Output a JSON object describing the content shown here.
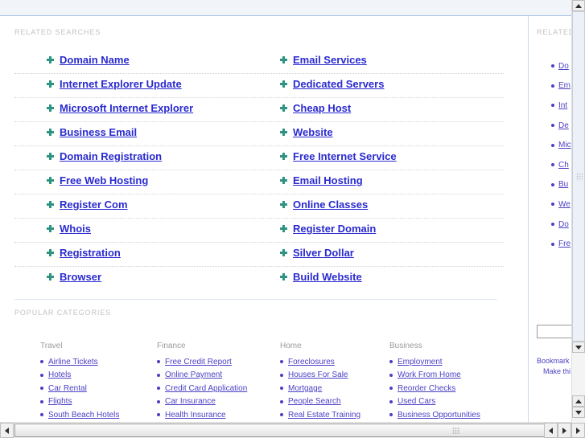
{
  "colors": {
    "link": "#2a2ad0",
    "category_link": "#4b3fc4",
    "bullet_star": "#2e9481",
    "header_band": "#f1f5fa",
    "header_border": "#a8c3e0",
    "section_head": "#c3c3c3"
  },
  "main": {
    "related_searches": {
      "heading": "RELATED SEARCHES",
      "rows": [
        {
          "left": "Domain Name",
          "right": "Email Services"
        },
        {
          "left": "Internet Explorer Update",
          "right": "Dedicated Servers"
        },
        {
          "left": "Microsoft Internet Explorer",
          "right": "Cheap Host"
        },
        {
          "left": "Business Email",
          "right": "Website"
        },
        {
          "left": "Domain Registration",
          "right": "Free Internet Service"
        },
        {
          "left": "Free Web Hosting",
          "right": "Email Hosting"
        },
        {
          "left": "Register Com",
          "right": "Online Classes"
        },
        {
          "left": "Whois",
          "right": "Register Domain"
        },
        {
          "left": "Registration",
          "right": "Silver Dollar"
        },
        {
          "left": "Browser",
          "right": "Build Website"
        }
      ]
    },
    "popular_categories": {
      "heading": "POPULAR CATEGORIES",
      "columns": [
        {
          "title": "Travel",
          "items": [
            "Airline Tickets",
            "Hotels",
            "Car Rental",
            "Flights",
            "South Beach Hotels"
          ]
        },
        {
          "title": "Finance",
          "items": [
            "Free Credit Report",
            "Online Payment",
            "Credit Card Application",
            "Car Insurance",
            "Health Insurance"
          ]
        },
        {
          "title": "Home",
          "items": [
            "Foreclosures",
            "Houses For Sale",
            "Mortgage",
            "People Search",
            "Real Estate Training"
          ]
        },
        {
          "title": "Business",
          "items": [
            "Employment",
            "Work From Home",
            "Reorder Checks",
            "Used Cars",
            "Business Opportunities"
          ]
        }
      ]
    }
  },
  "right_panel": {
    "heading": "RELATED",
    "links": [
      "Do",
      "Em",
      "Int",
      "De",
      "Mic",
      "Ch",
      "Bu",
      "We",
      "Do",
      "Fre"
    ],
    "search_value": "",
    "footer": {
      "bookmark": "Bookmark",
      "make_this": "Make thi"
    }
  }
}
